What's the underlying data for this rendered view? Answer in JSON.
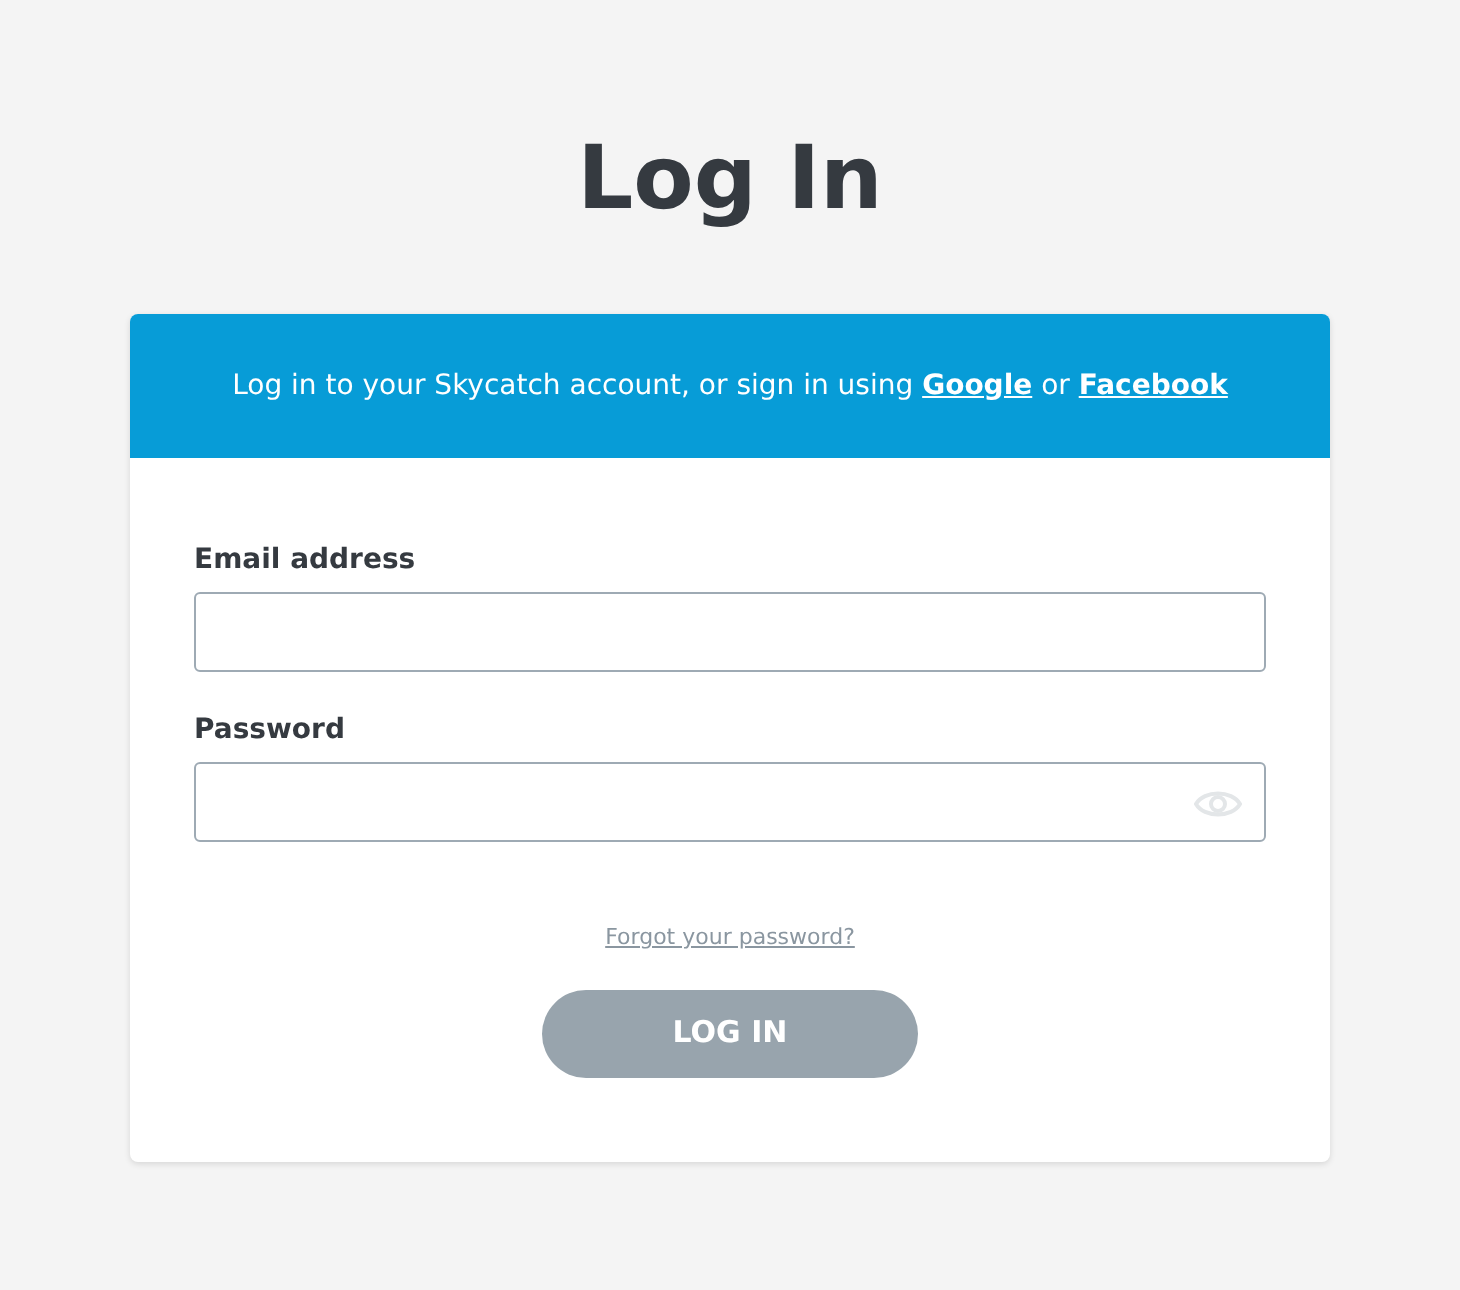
{
  "title": "Log In",
  "banner": {
    "text": "Log in to your Skycatch account, or sign in using",
    "links": [
      {
        "label": "Google"
      },
      {
        "label": "Facebook"
      }
    ],
    "joiner": "or"
  },
  "fields": [
    {
      "label": "Email address",
      "kind": "text"
    },
    {
      "label": "Password",
      "kind": "password"
    }
  ],
  "forgot_link": "Forgot your password?",
  "submit": {
    "label": "LOG IN",
    "disabled": true
  }
}
